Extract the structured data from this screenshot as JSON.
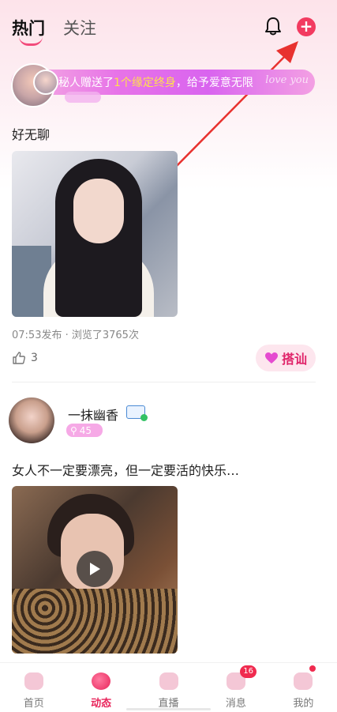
{
  "header": {
    "tab_hot": "热门",
    "tab_follow": "关注",
    "bell_icon": "bell-icon",
    "add_icon": "plus-icon"
  },
  "gift_banner": {
    "sender": "秘人",
    "action": " 赠送了",
    "gift": "1个缘定终身",
    "suffix": "，给予爱意无限",
    "script_text": "love you"
  },
  "post1": {
    "text": "好无聊",
    "meta": "07:53发布 · 浏览了3765次",
    "likes": "3",
    "greet_label": "搭讪"
  },
  "post2": {
    "username": "一抹幽香",
    "level": "45",
    "text": "女人不一定要漂亮，但一定要活的快乐…"
  },
  "tabbar": {
    "items": [
      {
        "label": "首页"
      },
      {
        "label": "动态"
      },
      {
        "label": "直播"
      },
      {
        "label": "消息",
        "badge": "16"
      },
      {
        "label": "我的"
      }
    ]
  },
  "colors": {
    "accent": "#f23b60",
    "greet_text": "#e0246a",
    "banner_gradient_start": "#f6b4e0",
    "banner_gradient_end": "#d964ef"
  }
}
